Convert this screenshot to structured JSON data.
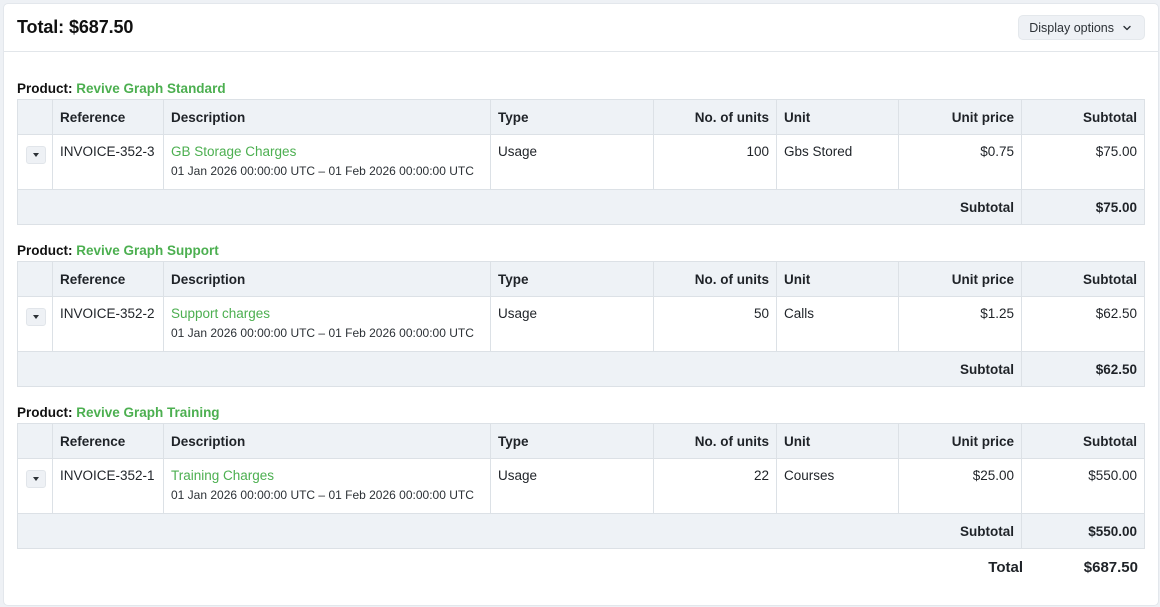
{
  "header": {
    "total_label": "Total: $687.50",
    "display_options_label": "Display options"
  },
  "columns": {
    "reference": "Reference",
    "description": "Description",
    "type": "Type",
    "units": "No. of units",
    "unit": "Unit",
    "unit_price": "Unit price",
    "subtotal": "Subtotal"
  },
  "product_prefix": "Product:",
  "sections": [
    {
      "product": "Revive Graph Standard",
      "row": {
        "reference": "INVOICE-352-3",
        "description": "GB Storage Charges",
        "period": "01 Jan 2026 00:00:00 UTC – 01 Feb 2026 00:00:00 UTC",
        "type": "Usage",
        "units": "100",
        "unit": "Gbs Stored",
        "unit_price": "$0.75",
        "subtotal": "$75.00"
      },
      "subtotal_label": "Subtotal",
      "subtotal_value": "$75.00"
    },
    {
      "product": "Revive Graph Support",
      "row": {
        "reference": "INVOICE-352-2",
        "description": "Support charges",
        "period": "01 Jan 2026 00:00:00 UTC – 01 Feb 2026 00:00:00 UTC",
        "type": "Usage",
        "units": "50",
        "unit": "Calls",
        "unit_price": "$1.25",
        "subtotal": "$62.50"
      },
      "subtotal_label": "Subtotal",
      "subtotal_value": "$62.50"
    },
    {
      "product": "Revive Graph Training",
      "row": {
        "reference": "INVOICE-352-1",
        "description": "Training Charges",
        "period": "01 Jan 2026 00:00:00 UTC – 01 Feb 2026 00:00:00 UTC",
        "type": "Usage",
        "units": "22",
        "unit": "Courses",
        "unit_price": "$25.00",
        "subtotal": "$550.00"
      },
      "subtotal_label": "Subtotal",
      "subtotal_value": "$550.00"
    }
  ],
  "grand_total": {
    "label": "Total",
    "value": "$687.50"
  },
  "colors": {
    "accent_green": "#4caf50",
    "header_bg": "#eef2f6"
  },
  "icons": {
    "display_options": "chevron-down-icon",
    "row_toggle": "caret-down-icon"
  }
}
